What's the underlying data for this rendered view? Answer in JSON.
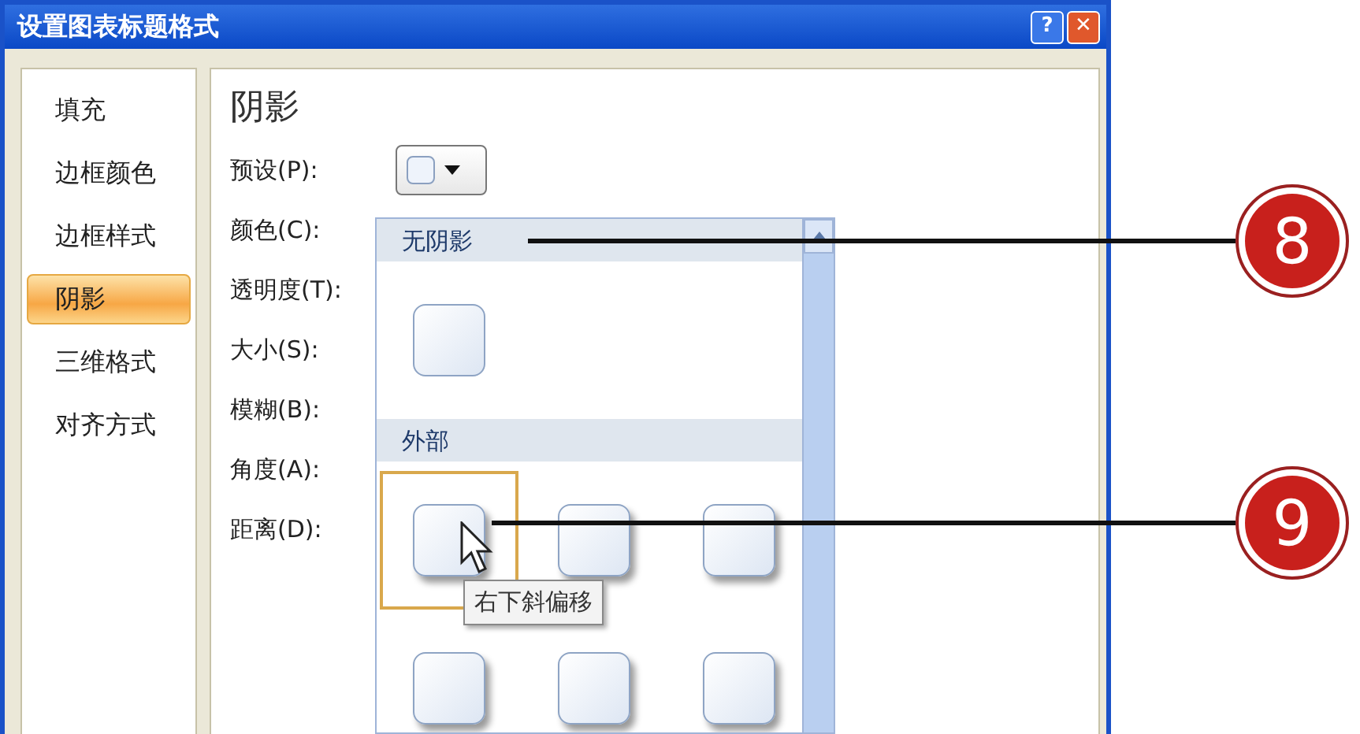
{
  "window": {
    "title": "设置图表标题格式",
    "buttons": [
      {
        "kind": "help",
        "label": "?"
      },
      {
        "kind": "close",
        "label": "✕"
      }
    ]
  },
  "sidebar": {
    "items": [
      {
        "label": "填充",
        "selected": false
      },
      {
        "label": "边框颜色",
        "selected": false
      },
      {
        "label": "边框样式",
        "selected": false
      },
      {
        "label": "阴影",
        "selected": true
      },
      {
        "label": "三维格式",
        "selected": false
      },
      {
        "label": "对齐方式",
        "selected": false
      }
    ]
  },
  "panel": {
    "heading": "阴影",
    "fields": [
      {
        "label": "预设(P):",
        "kind": "preset"
      },
      {
        "label": "颜色(C):"
      },
      {
        "label": "透明度(T):"
      },
      {
        "label": "大小(S):"
      },
      {
        "label": "模糊(B):"
      },
      {
        "label": "角度(A):"
      },
      {
        "label": "距离(D):"
      }
    ]
  },
  "gallery": {
    "sections": [
      {
        "title": "无阴影",
        "tiles": [
          {
            "selected": false
          }
        ]
      },
      {
        "title": "外部",
        "tiles": [
          {
            "selected": true
          },
          {
            "selected": false
          },
          {
            "selected": false
          },
          {
            "selected": false
          },
          {
            "selected": false
          },
          {
            "selected": false
          }
        ]
      }
    ],
    "tooltip": "右下斜偏移"
  },
  "callouts": [
    {
      "number": "8"
    },
    {
      "number": "9"
    }
  ]
}
